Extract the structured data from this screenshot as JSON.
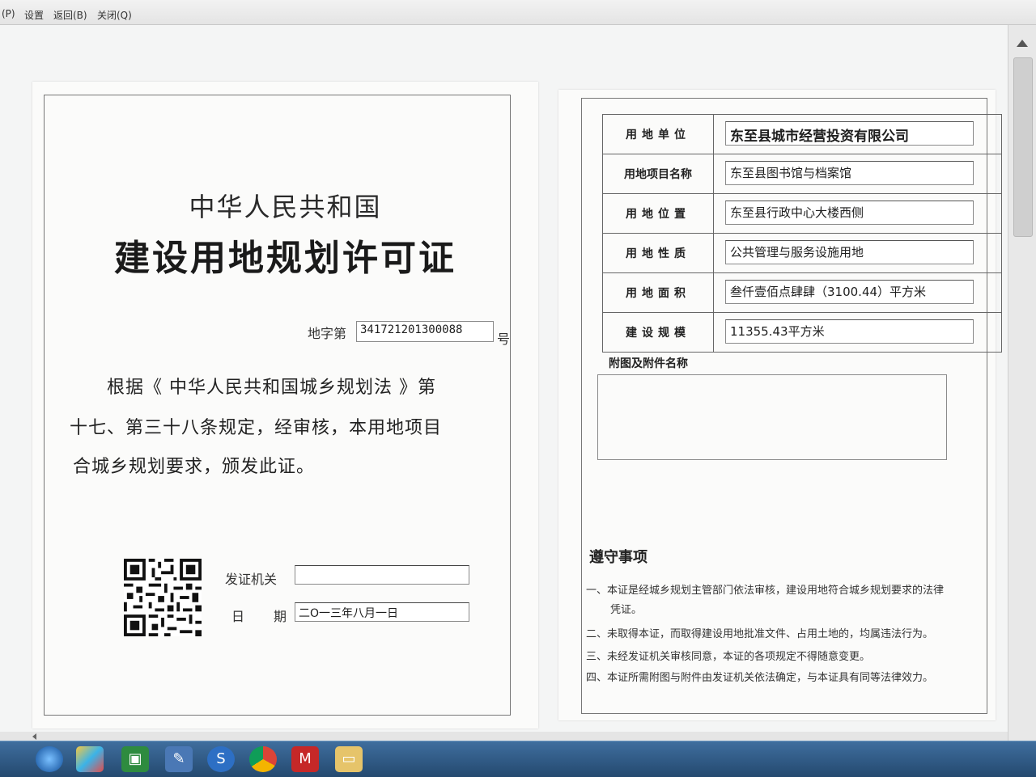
{
  "menu": {
    "items": [
      "(P)",
      "设置",
      "返回(B)",
      "关闭(Q)"
    ]
  },
  "certificate": {
    "country": "中华人民共和国",
    "title": "建设用地规划许可证",
    "permit_label": "地字第",
    "permit_number": "341721201300088",
    "permit_suffix": "号",
    "body_lines": [
      "根据《 中华人民共和国城乡规划法 》第",
      "十七、第三十八条规定，经审核，本用地项目",
      "合城乡规划要求，颁发此证。"
    ],
    "issuer_label": "发证机关",
    "issuer_value": "",
    "date_label_1": "日",
    "date_label_2": "期",
    "date_value": "二O一三年八月一日"
  },
  "land": {
    "rows": [
      {
        "label": "用地单位",
        "value": "东至县城市经营投资有限公司"
      },
      {
        "label": "用地项目名称",
        "value": "东至县图书馆与档案馆"
      },
      {
        "label": "用地位置",
        "value": "东至县行政中心大楼西侧"
      },
      {
        "label": "用地性质",
        "value": "公共管理与服务设施用地"
      },
      {
        "label": "用地面积",
        "value": "叁仟壹佰点肆肆（3100.44）平方米"
      },
      {
        "label": "建设规模",
        "value": "11355.43平方米"
      }
    ],
    "attach_label": "附图及附件名称",
    "attach_value": ""
  },
  "notes": {
    "title": "遵守事项",
    "items": [
      "一、本证是经城乡规划主管部门依法审核，建设用地符合城乡规划要求的法律",
      "凭证。",
      "二、未取得本证，而取得建设用地批准文件、占用土地的，均属违法行为。",
      "三、未经发证机关审核同意，本证的各项规定不得随意变更。",
      "四、本证所需附图与附件由发证机关依法确定，与本证具有同等法律效力。"
    ]
  },
  "taskbar": {
    "icons": [
      "start-orb-icon",
      "colorful-app-icon",
      "green-window-icon",
      "pen-tool-icon",
      "s-browser-icon",
      "chrome-icon",
      "mcafee-shield-icon",
      "folder-icon"
    ]
  }
}
